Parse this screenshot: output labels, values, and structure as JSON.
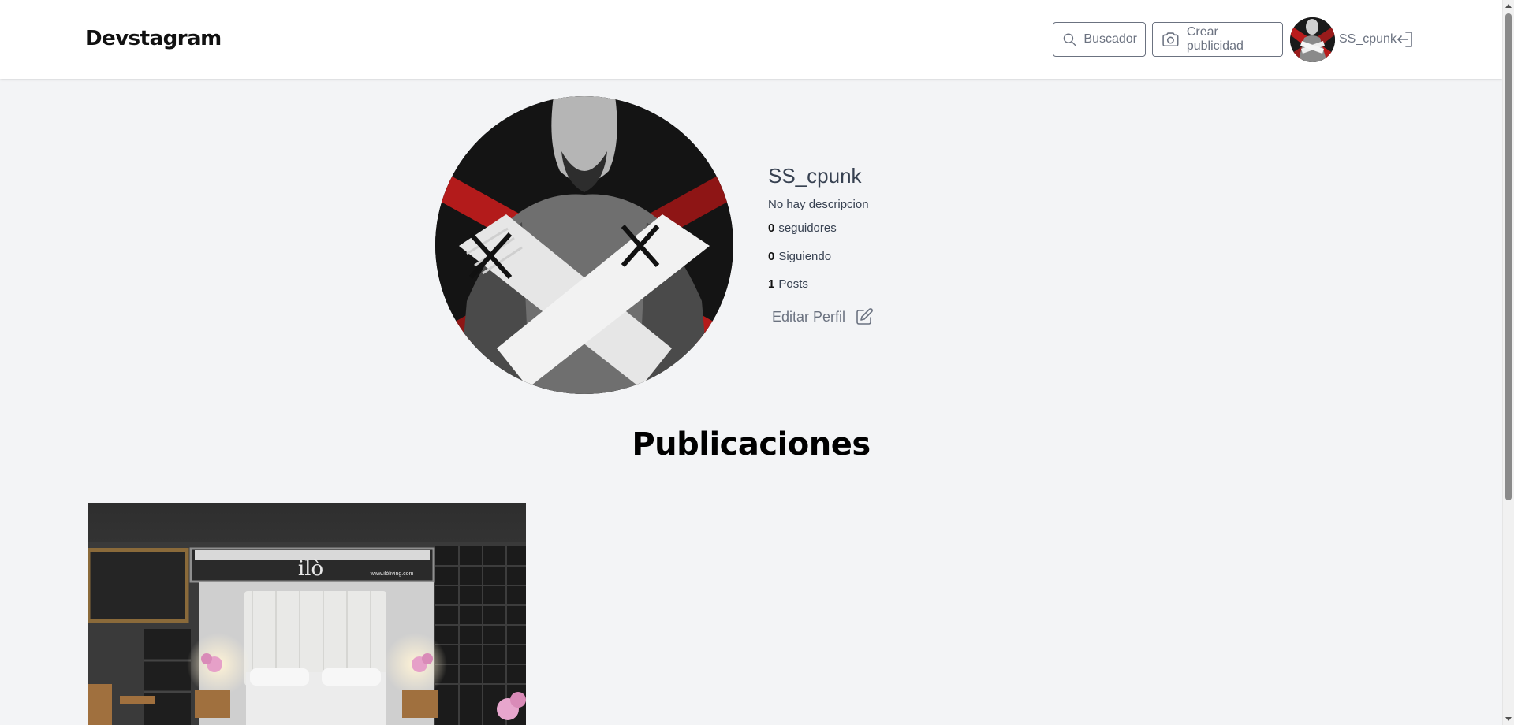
{
  "header": {
    "brand": "Devstagram",
    "search_label": "Buscador",
    "create_label": "Crear publicidad",
    "username": "SS_cpunk"
  },
  "profile": {
    "username": "SS_cpunk",
    "description": "No hay descripcion",
    "followers_count": "0",
    "followers_label": "seguidores",
    "following_count": "0",
    "following_label": "Siguiendo",
    "posts_count": "1",
    "posts_label": "Posts",
    "edit_label": "Editar Perfil"
  },
  "posts_section": {
    "title": "Publicaciones",
    "post_banner_text": "www.ilòliving.com",
    "post_logo_text": "ilò"
  },
  "colors": {
    "page_bg": "#f3f4f6",
    "header_bg": "#ffffff",
    "text_dark": "#374151",
    "text_muted": "#6b7280"
  }
}
